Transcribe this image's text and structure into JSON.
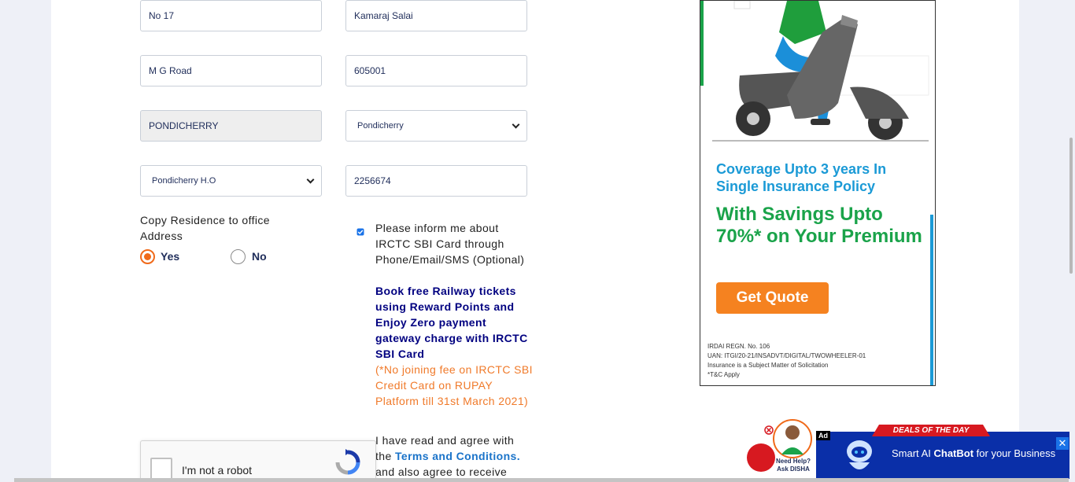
{
  "form": {
    "address_line1": "No 17",
    "address_line2": "Kamaraj Salai",
    "address_line3": "M G Road",
    "pincode": "605001",
    "city": "PONDICHERRY",
    "state_selected": "Pondicherry",
    "post_office_selected": "Pondicherry H.O",
    "phone": "2256674"
  },
  "copy_address": {
    "label": "Copy Residence to office Address",
    "yes_label": "Yes",
    "no_label": "No",
    "selected": "Yes"
  },
  "consent": {
    "inform_text": "Please inform me about IRCTC SBI Card through Phone/Email/SMS (Optional)",
    "promo_text": "Book free Railway tickets using Reward Points and Enjoy Zero payment gateway charge with IRCTC SBI Card",
    "note_text": "(*No joining fee on IRCTC SBI Credit Card on RUPAY Platform till 31st March 2021)",
    "agree_prefix": "I have read and agree with the",
    "agree_link": "Terms and Conditions.",
    "agree_suffix": "and also agree to receive",
    "checked": true
  },
  "captcha": {
    "label": "I'm not a robot"
  },
  "ad": {
    "headline1": "Coverage Upto 3 years In Single Insurance Policy",
    "headline2": "With Savings Upto 70%* on Your Premium",
    "button": "Get Quote",
    "fine1": "IRDAI REGN. No. 106",
    "fine2": "UAN: ITGI/20-21/INSADVT/DIGITAL/TWOWHEELER-01",
    "fine3": "Insurance is a Subject Matter of Solicitation",
    "fine4": "*T&C Apply"
  },
  "bottom_ad": {
    "tag": "Ad",
    "deals": "DEALS OF THE DAY",
    "text_prefix": "Smart AI",
    "text_bold": "ChatBot",
    "text_suffix": "for your Business",
    "close": "✕",
    "disha_line1": "Need Help?",
    "disha_line2": "Ask DISHA"
  },
  "colors": {
    "accent": "#f06a1a",
    "navy": "#000080",
    "link": "#1a73c9",
    "ad_green": "#1aa34a",
    "ad_blue": "#1b9ad6",
    "ad_orange": "#f58220"
  }
}
